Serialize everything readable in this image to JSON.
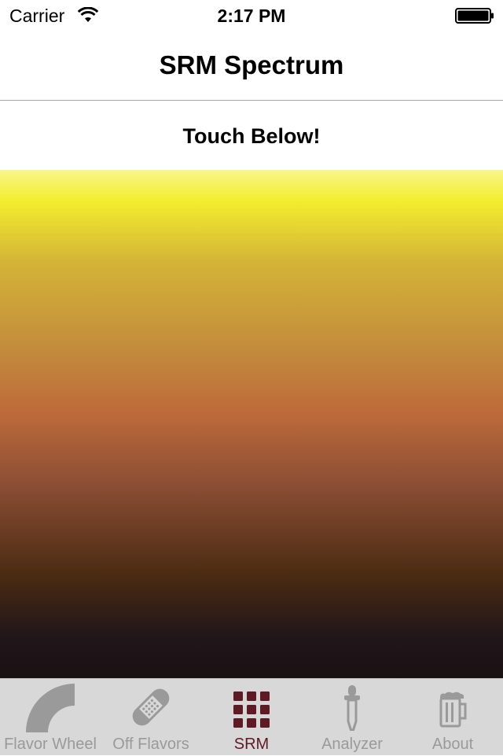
{
  "status_bar": {
    "carrier": "Carrier",
    "time": "2:17 PM"
  },
  "nav": {
    "title": "SRM Spectrum"
  },
  "instruction": "Touch Below!",
  "spectrum": {
    "colors": [
      "#f8f68a",
      "#f3ee2e",
      "#d4b437",
      "#c38c3c",
      "#bd6a3a",
      "#8b4e34",
      "#4a2a12",
      "#21161a",
      "#1a1113"
    ]
  },
  "tabs": [
    {
      "label": "Flavor Wheel",
      "icon": "quarter-wheel-icon",
      "active": false
    },
    {
      "label": "Off Flavors",
      "icon": "bandage-icon",
      "active": false
    },
    {
      "label": "SRM",
      "icon": "grid-icon",
      "active": true
    },
    {
      "label": "Analyzer",
      "icon": "dropper-icon",
      "active": false
    },
    {
      "label": "About",
      "icon": "beer-mug-icon",
      "active": false
    }
  ],
  "colors": {
    "tab_active": "#5f1a25",
    "tab_inactive": "#9a9a9a",
    "tab_bar_bg": "#d8d8d8"
  }
}
